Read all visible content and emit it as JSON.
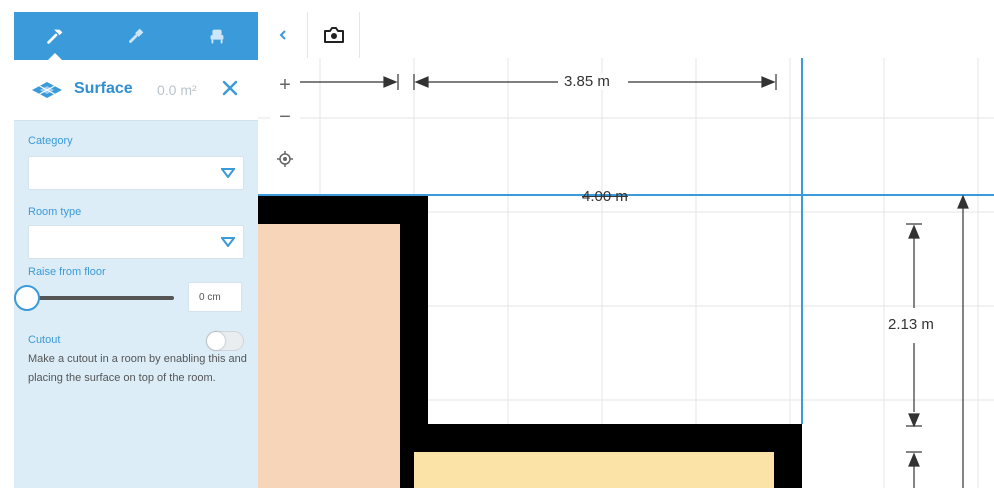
{
  "sidebar": {
    "tabs": [
      {
        "icon": "hammer-icon",
        "active": true
      },
      {
        "icon": "paintbrush-icon",
        "active": false
      },
      {
        "icon": "armchair-icon",
        "active": false
      }
    ],
    "panel": {
      "title": "Surface",
      "area": "0.0 m²",
      "icon": "surface-icon"
    },
    "category": {
      "label": "Category",
      "value": ""
    },
    "room_type": {
      "label": "Room type",
      "value": ""
    },
    "raise": {
      "label": "Raise from floor",
      "value": "0 cm",
      "level": 0
    },
    "cutout": {
      "label": "Cutout",
      "enabled": false,
      "description": "Make a cutout in a room by enabling this and placing the surface on top of the room."
    }
  },
  "toolbar": {
    "back_icon": "chevron-left-icon",
    "camera_icon": "camera-icon"
  },
  "canvas": {
    "zoom_in": "+",
    "zoom_out": "−",
    "recenter_icon": "target-icon",
    "dimensions": {
      "top": "3.85 m",
      "wall": "4.00 m",
      "right": "2.13 m"
    }
  },
  "colors": {
    "accent": "#3b9ad9",
    "sidebar_bg": "#dcedf7",
    "room_peach": "#f6d5b8",
    "room_yellow": "#fbe2a6",
    "wall": "#000000"
  }
}
